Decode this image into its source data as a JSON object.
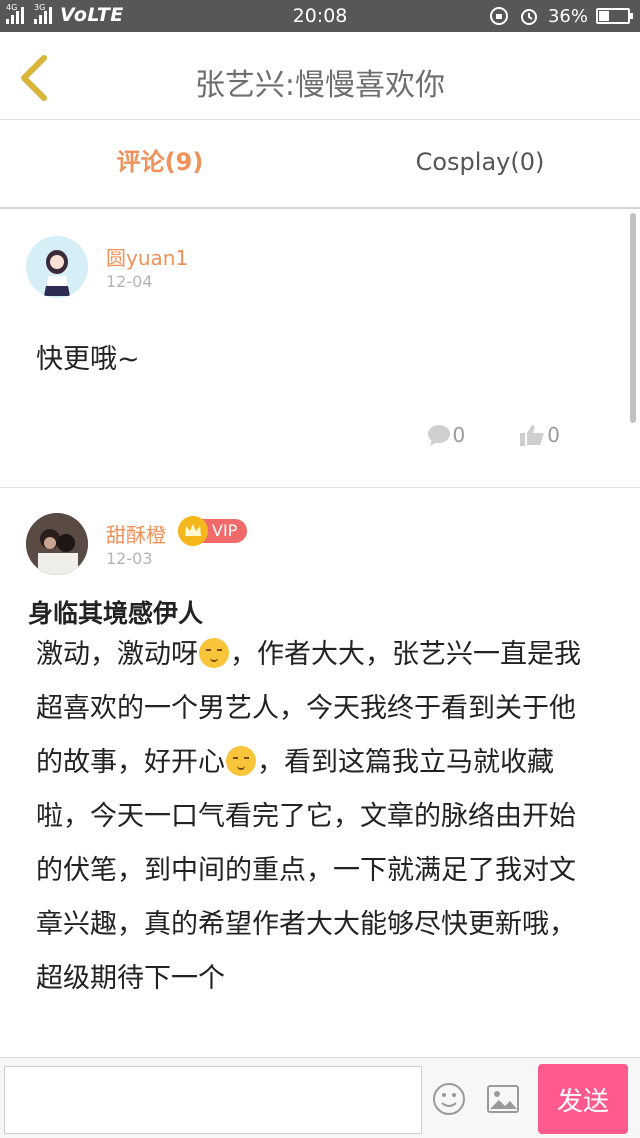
{
  "status_bar": {
    "network_tags": [
      "4G",
      "3G"
    ],
    "volte": "VoLTE",
    "time": "20:08",
    "battery": "36%",
    "battery_level": 0.36
  },
  "header": {
    "title": "张艺兴:慢慢喜欢你",
    "back_icon": "chevron-left-icon",
    "accent_color": "#f0915a"
  },
  "tabs": [
    {
      "label": "评论(9)",
      "active": true
    },
    {
      "label": "Cosplay(0)",
      "active": false
    }
  ],
  "comments": [
    {
      "user": "圆yuan1",
      "date": "12-04",
      "text": "快更哦~",
      "reply_count": "0",
      "like_count": "0"
    },
    {
      "user": "甜酥橙",
      "badge": "VIP",
      "date": "12-03",
      "subject": "身临其境感伊人",
      "text_parts": [
        "激动，激动呀",
        "，作者大大，张艺兴一直是我超喜欢的一个男艺人，今天我终于看到关于他的故事，好开心",
        "，看到这篇我立马就收藏啦，今天一口气看完了它，文章的脉络由开始的伏笔，到中间的重点，一下就满足了我对文章兴趣，真的希望作者大大能够尽快更新哦，超级期待下一个"
      ]
    }
  ],
  "bottom_bar": {
    "input_placeholder": "",
    "send_label": "发送",
    "send_color": "#ff5a8e"
  }
}
